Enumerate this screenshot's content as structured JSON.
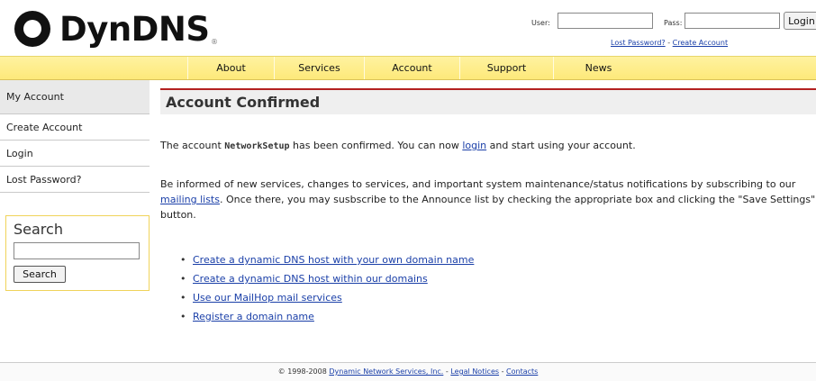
{
  "logo": {
    "text": "DynDNS",
    "reg_mark": "®",
    "icon": "dyndns-logo-icon"
  },
  "login": {
    "user_label": "User:",
    "user_value": "",
    "pass_label": "Pass:",
    "pass_value": "",
    "button_label": "Login",
    "lost_password": "Lost Password?",
    "separator": " - ",
    "create_account": "Create Account"
  },
  "nav": [
    "About",
    "Services",
    "Account",
    "Support",
    "News"
  ],
  "sidebar": {
    "items": [
      {
        "label": "My Account"
      },
      {
        "label": "Create Account"
      },
      {
        "label": "Login"
      },
      {
        "label": "Lost Password?"
      }
    ],
    "search": {
      "title": "Search",
      "input_value": "",
      "button_label": "Search"
    }
  },
  "main": {
    "title": "Account Confirmed",
    "para1": {
      "before": "The account ",
      "account": "NetworkSetup",
      "middle": " has been confirmed. You can now ",
      "link": "login",
      "after": " and start using your account."
    },
    "para2": {
      "before": "Be informed of new services, changes to services, and important system maintenance/status notifications by subscribing to our ",
      "link": "mailing lists",
      "after": ". Once there, you may susbscribe to the Announce list by checking the appropriate box and clicking the \"Save Settings\" button."
    },
    "links": [
      "Create a dynamic DNS host with your own domain name",
      "Create a dynamic DNS host within our domains",
      "Use our MailHop mail services",
      "Register a domain name"
    ]
  },
  "footer": {
    "copyright": "© 1998-2008 ",
    "company": "Dynamic Network Services, Inc.",
    "sep": " - ",
    "legal": "Legal Notices",
    "contacts": "Contacts"
  },
  "colors": {
    "nav_bg": "#fde97a",
    "title_rule": "#b32020",
    "link": "#1a3fa8",
    "logo_accent": "#f39c12"
  }
}
